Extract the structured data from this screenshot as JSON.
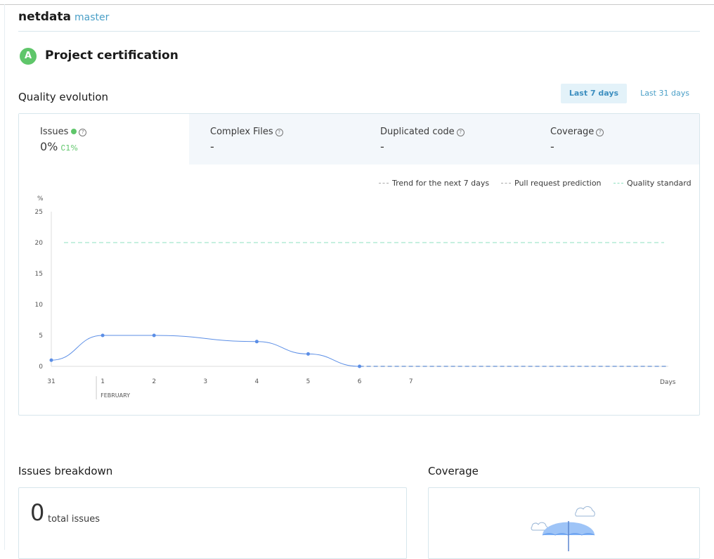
{
  "header": {
    "project": "netdata",
    "branch": "master"
  },
  "certification": {
    "grade": "A",
    "title": "Project certification"
  },
  "quality": {
    "title": "Quality evolution",
    "ranges": [
      "Last 7 days",
      "Last 31 days"
    ],
    "active_range": "Last 7 days",
    "tabs": [
      {
        "label": "Issues",
        "value": "0%",
        "delta": "∁1%"
      },
      {
        "label": "Complex Files",
        "value": "-"
      },
      {
        "label": "Duplicated code",
        "value": "-"
      },
      {
        "label": "Coverage",
        "value": "-"
      }
    ],
    "legend": [
      "Trend for the next 7 days",
      "Pull request prediction",
      "Quality standard"
    ]
  },
  "chart_data": {
    "type": "line",
    "ylabel": "%",
    "xlabel": "Days",
    "x": [
      "31",
      "1",
      "2",
      "3",
      "4",
      "5",
      "6",
      "7"
    ],
    "month_label": "FEBRUARY",
    "ylim": [
      0,
      25
    ],
    "yticks": [
      0,
      5,
      10,
      15,
      20,
      25
    ],
    "series": [
      {
        "name": "Issues",
        "x": [
          "31",
          "1",
          "2",
          "4",
          "5",
          "6"
        ],
        "values": [
          1,
          5,
          5,
          4,
          2,
          0
        ]
      }
    ],
    "trend": {
      "from": "6",
      "to": "Days",
      "value": 0
    },
    "quality_standard": 20,
    "colors": {
      "line": "#5b8ee6",
      "standard": "#8de0c0",
      "axis": "#cccccc"
    }
  },
  "issues_breakdown": {
    "title": "Issues breakdown",
    "total": "0",
    "total_label": "total issues"
  },
  "coverage": {
    "title": "Coverage"
  }
}
